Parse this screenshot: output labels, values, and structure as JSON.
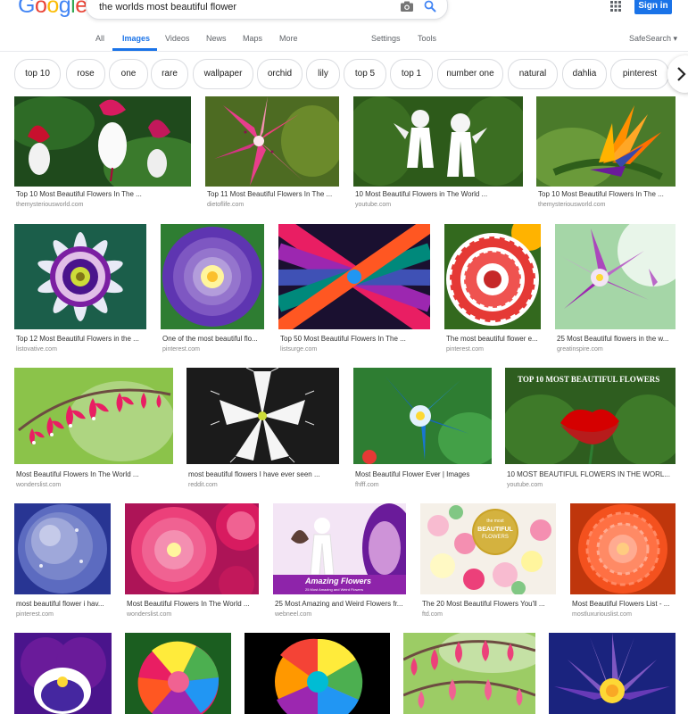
{
  "header": {
    "logo_letters": [
      "G",
      "o",
      "o",
      "g",
      "l",
      "e"
    ],
    "logo_colors": [
      "#4285f4",
      "#ea4335",
      "#fbbc05",
      "#4285f4",
      "#34a853",
      "#ea4335"
    ],
    "search_value": "the worlds most beautiful flower",
    "sign_in_label": "Sign in",
    "icons": [
      "camera-icon",
      "search-icon",
      "apps-grid-icon"
    ]
  },
  "tabs": {
    "all": "All",
    "images": "Images",
    "videos": "Videos",
    "news": "News",
    "maps": "Maps",
    "more": "More",
    "settings": "Settings",
    "tools": "Tools",
    "safesearch": "SafeSearch ▾",
    "active": "Images"
  },
  "chips": [
    "top 10",
    "rose",
    "one",
    "rare",
    "wallpaper",
    "orchid",
    "lily",
    "top 5",
    "top 1",
    "number one",
    "natural",
    "dahlia",
    "pinterest"
  ],
  "chip_next_label": "›",
  "results": [
    {
      "title": "Top 10 Most Beautiful Flowers In The ...",
      "source": "themysteriousworld.com"
    },
    {
      "title": "Top 11 Most Beautiful Flowers In The ...",
      "source": "dietoflife.com"
    },
    {
      "title": "10 Most Beautiful Flowers in The World ...",
      "source": "youtube.com"
    },
    {
      "title": "Top 10 Most Beautiful Flowers In The ...",
      "source": "themysteriousworld.com"
    },
    {
      "title": "Top 12 Most Beautiful Flowers in the ...",
      "source": "listovative.com"
    },
    {
      "title": "One of the most beautiful flo...",
      "source": "pinterest.com"
    },
    {
      "title": "Top 50 Most Beautiful Flowers In The ...",
      "source": "listsurge.com"
    },
    {
      "title": "The most beautiful flower e...",
      "source": "pinterest.com"
    },
    {
      "title": "25 Most Beautiful flowers in the w...",
      "source": "greatinspire.com"
    },
    {
      "title": "Most Beautiful Flowers In The World ...",
      "source": "wonderslist.com"
    },
    {
      "title": "most beautiful flowers I have ever seen ...",
      "source": "reddit.com"
    },
    {
      "title": "Most Beautiful Flower Ever | Images",
      "source": "fhfff.com"
    },
    {
      "title": "10 MOST BEAUTIFUL FLOWERS IN THE WORL...",
      "source": "youtube.com"
    },
    {
      "title": "most beautiful flower i hav...",
      "source": "pinterest.com"
    },
    {
      "title": "Most Beautiful Flowers In The World ...",
      "source": "wonderslist.com"
    },
    {
      "title": "25 Most Amazing and Weird Flowers fr...",
      "source": "webneel.com"
    },
    {
      "title": "The 20 Most Beautiful Flowers You'll ...",
      "source": "ftd.com"
    },
    {
      "title": "Most Beautiful Flowers List - ...",
      "source": "mostluxuriouslist.com"
    }
  ],
  "overlay_texts": {
    "top10_banner": "TOP 10 MOST BEAUTIFUL FLOWERS",
    "amazing": "Amazing Flowers",
    "amazing_sub": "25 Most Amazing and Weird Flowers",
    "ftd_badge_1": "the most",
    "ftd_badge_2": "BEAUTIFUL",
    "ftd_badge_3": "FLOWERS"
  }
}
